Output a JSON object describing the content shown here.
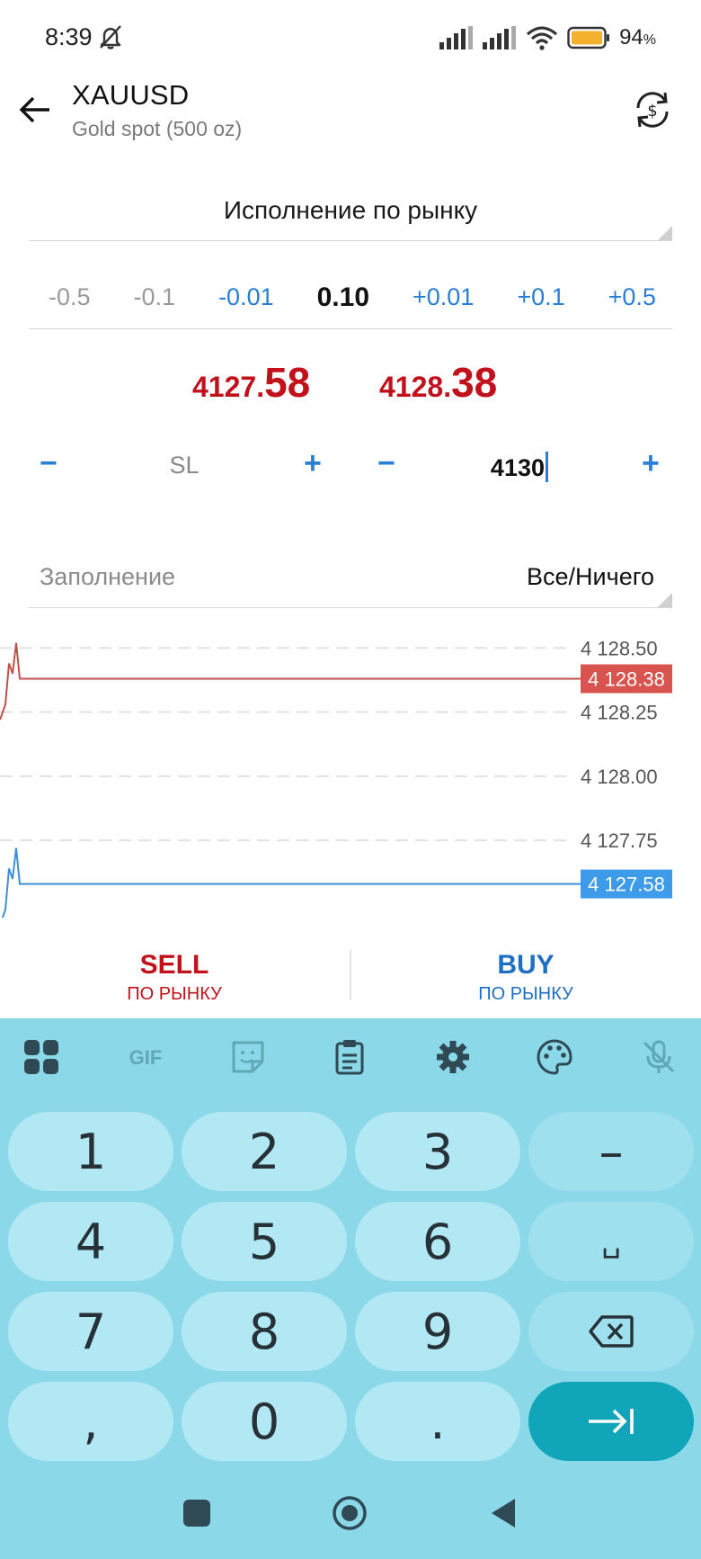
{
  "status_bar": {
    "time": "8:39",
    "battery_percent": "94",
    "battery_unit": "%",
    "icons": [
      "bell-off-icon",
      "signal-icon",
      "signal-icon",
      "wifi-icon",
      "battery-icon"
    ]
  },
  "header": {
    "symbol": "XAUUSD",
    "description": "Gold spot (500 oz)",
    "back_icon": "arrow-left-icon",
    "swap_icon": "currency-swap-icon"
  },
  "order_type": {
    "label": "Исполнение по рынку"
  },
  "volume": {
    "minus_05": "-0.5",
    "minus_01": "-0.1",
    "minus_001": "-0.01",
    "value": "0.10",
    "plus_001": "+0.01",
    "plus_01": "+0.1",
    "plus_05": "+0.5"
  },
  "prices": {
    "bid_small": "4127.",
    "bid_big": "58",
    "ask_small": "4128.",
    "ask_big": "38"
  },
  "sltp": {
    "sl_minus": "−",
    "sl_placeholder": "SL",
    "sl_plus": "+",
    "tp_minus": "−",
    "tp_value": "4130",
    "tp_plus": "+"
  },
  "filling": {
    "label": "Заполнение",
    "value": "Все/Ничего"
  },
  "chart_data": {
    "type": "line",
    "y_ticks": [
      "4 128.50",
      "4 128.25",
      "4 128.00",
      "4 127.75"
    ],
    "ylim": [
      4127.47,
      4128.55
    ],
    "ask_badge": "4 128.38",
    "bid_badge": "4 127.58",
    "series": [
      {
        "values": [
          4128.22,
          4128.28,
          4128.44,
          4128.4,
          4128.52,
          4128.38,
          4128.38,
          4128.38
        ],
        "color": "#c0504a"
      },
      {
        "values": [
          4127.42,
          4127.48,
          4127.64,
          4127.6,
          4127.72,
          4127.58,
          4127.58,
          4127.58
        ],
        "color": "#3d8fd8"
      }
    ],
    "colors": {
      "ask": "#d9534f",
      "bid": "#3d9be9",
      "grid": "#e2e2e2"
    }
  },
  "trade": {
    "sell_label": "SELL",
    "sell_sub": "ПО РЫНКУ",
    "buy_label": "BUY",
    "buy_sub": "ПО РЫНКУ"
  },
  "keyboard": {
    "toolbar": [
      "apps-grid-icon",
      "gif-icon",
      "sticker-icon",
      "clipboard-icon",
      "settings-icon",
      "palette-icon",
      "mic-off-icon"
    ],
    "gif_label": "GIF",
    "k1": "1",
    "k2": "2",
    "k3": "3",
    "k_minus": "–",
    "k4": "4",
    "k5": "5",
    "k6": "6",
    "k_space": "␣",
    "k7": "7",
    "k8": "8",
    "k9": "9",
    "k_comma": ",",
    "k0": "0",
    "k_dot": ".",
    "backspace_icon": "backspace-icon",
    "enter_icon": "tab-enter-icon"
  },
  "navbar": {
    "icons": [
      "recents-icon",
      "home-icon",
      "back-icon"
    ]
  }
}
